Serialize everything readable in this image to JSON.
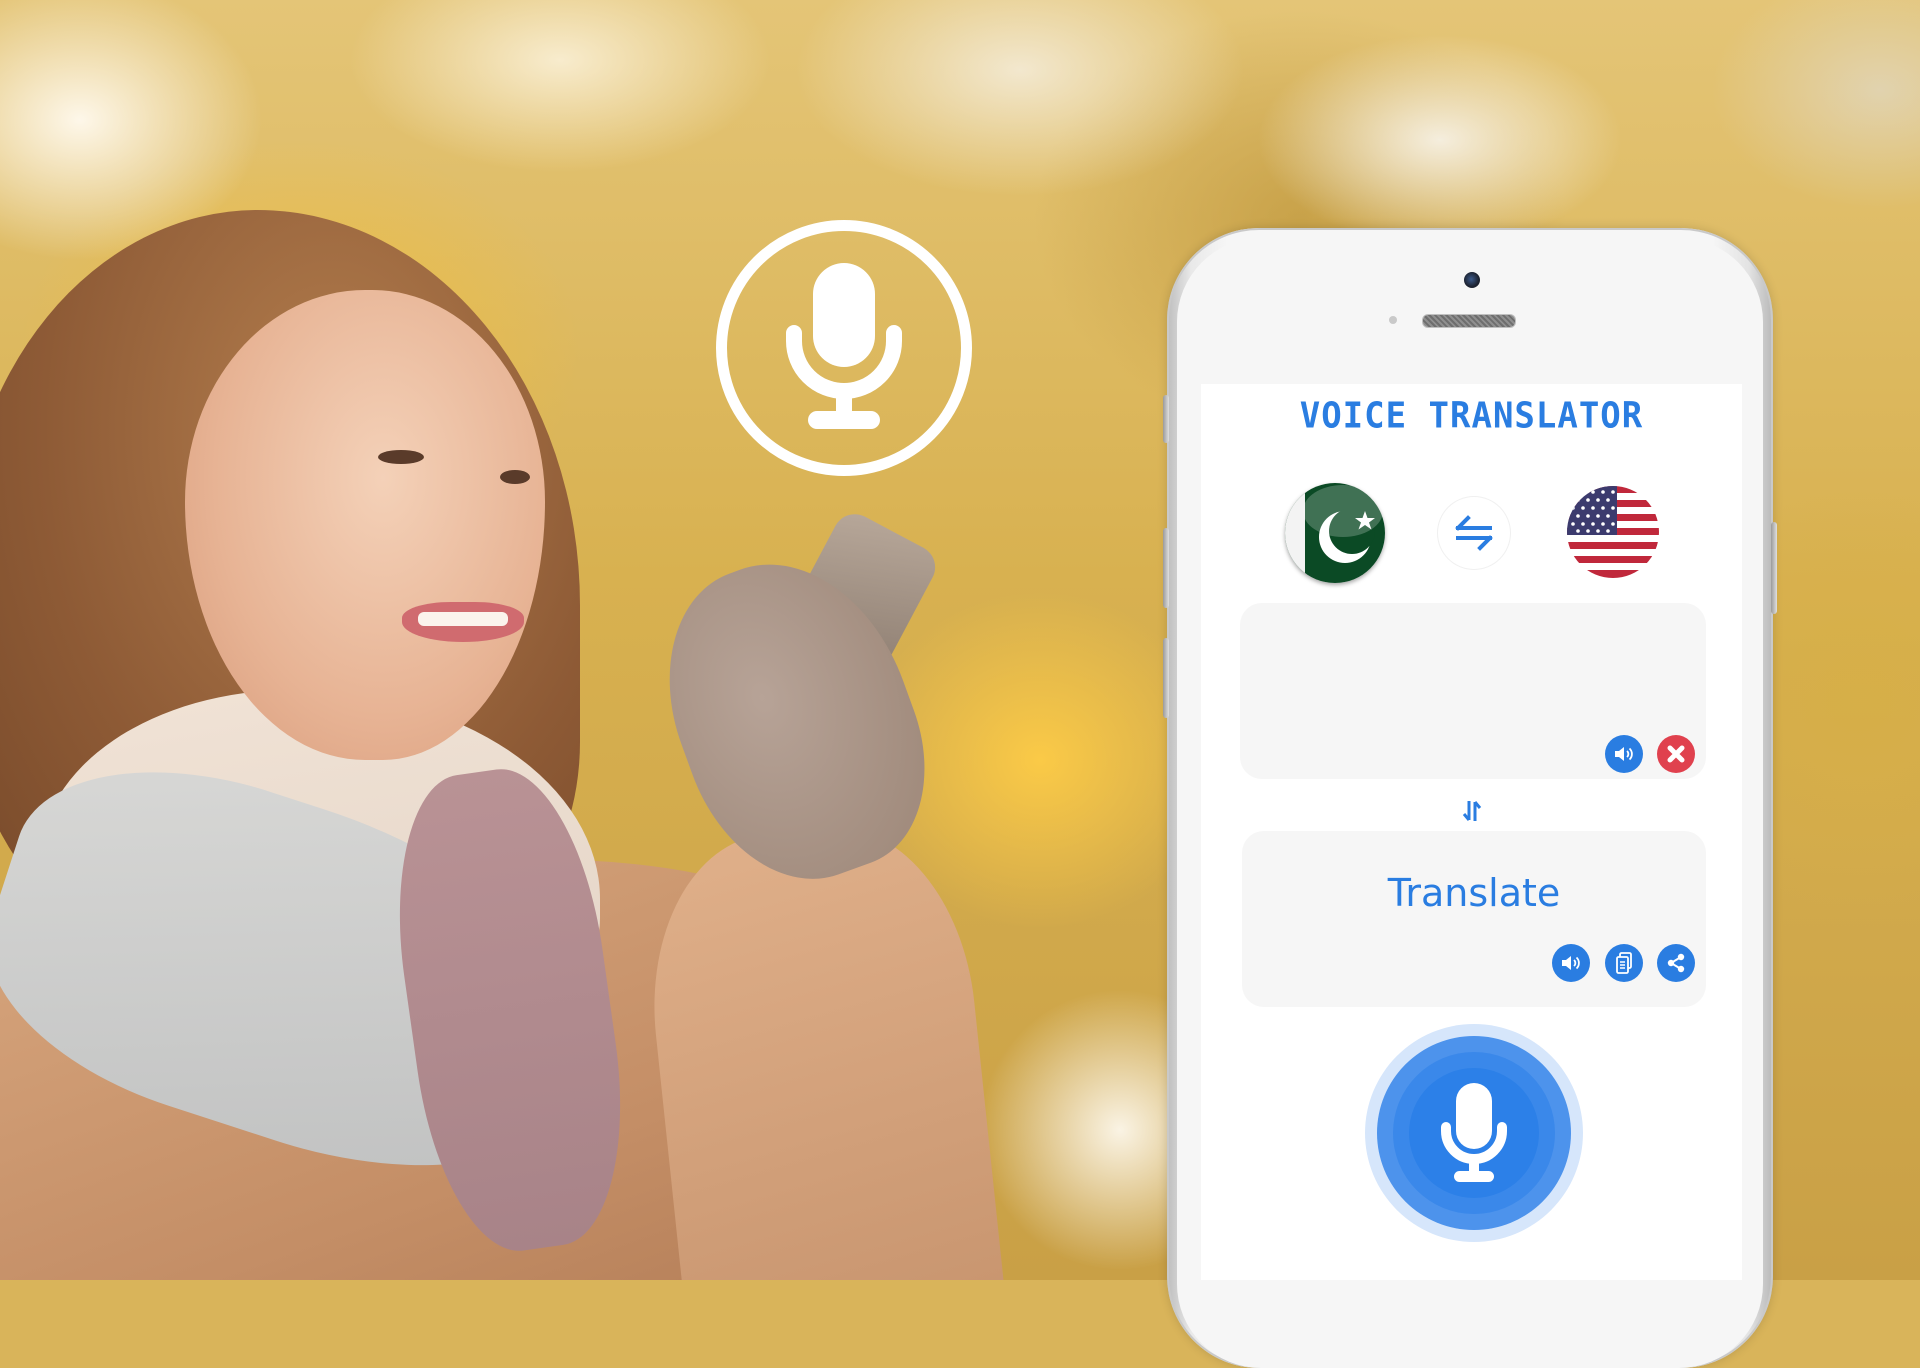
{
  "app": {
    "title": "VOICE TRANSLATOR"
  },
  "languages": {
    "source": {
      "name": "Pakistan",
      "icon": "pakistan-flag-icon"
    },
    "target": {
      "name": "United States",
      "icon": "us-flag-icon"
    },
    "swap_icon": "swap-arrows-icon"
  },
  "input_box": {
    "text": "",
    "actions": [
      {
        "name": "speak",
        "icon": "speaker-icon"
      },
      {
        "name": "clear",
        "icon": "close-icon"
      }
    ]
  },
  "output_box": {
    "placeholder": "Translate",
    "actions": [
      {
        "name": "speak",
        "icon": "speaker-icon"
      },
      {
        "name": "copy",
        "icon": "copy-icon"
      },
      {
        "name": "share",
        "icon": "share-icon"
      }
    ]
  },
  "mic_button": {
    "icon": "microphone-icon"
  },
  "overlay": {
    "icon": "microphone-icon"
  },
  "colors": {
    "accent": "#2a7de1",
    "danger": "#e0414e",
    "box_bg": "#f6f6f6"
  }
}
